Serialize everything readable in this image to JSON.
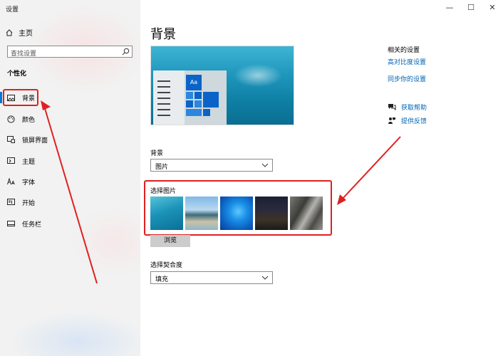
{
  "window": {
    "title": "设置",
    "minimize_icon": "—",
    "maximize_icon": "☐",
    "close_icon": "✕"
  },
  "sidebar": {
    "home_label": "主页",
    "search_placeholder": "查找设置",
    "section_title": "个性化",
    "items": [
      {
        "label": "背景",
        "icon": "image-icon",
        "active": true
      },
      {
        "label": "颜色",
        "icon": "palette-icon",
        "active": false
      },
      {
        "label": "锁屏界面",
        "icon": "lockscreen-icon",
        "active": false
      },
      {
        "label": "主题",
        "icon": "theme-icon",
        "active": false
      },
      {
        "label": "字体",
        "icon": "font-icon",
        "active": false
      },
      {
        "label": "开始",
        "icon": "start-icon",
        "active": false
      },
      {
        "label": "任务栏",
        "icon": "taskbar-icon",
        "active": false
      }
    ]
  },
  "main": {
    "page_title": "背景",
    "preview_sample_text": "Aa",
    "background_label": "背景",
    "background_value": "图片",
    "choose_picture_label": "选择图片",
    "browse_label": "浏览",
    "fit_label": "选择契合度",
    "fit_value": "填充"
  },
  "related": {
    "title": "相关的设置",
    "links": [
      "高对比度设置",
      "同步你的设置"
    ],
    "help": [
      {
        "label": "获取帮助",
        "icon": "help-chat-icon"
      },
      {
        "label": "提供反馈",
        "icon": "feedback-icon"
      }
    ]
  },
  "colors": {
    "accent": "#0078d7",
    "link": "#0063b1",
    "annotation_red": "#e02020"
  }
}
